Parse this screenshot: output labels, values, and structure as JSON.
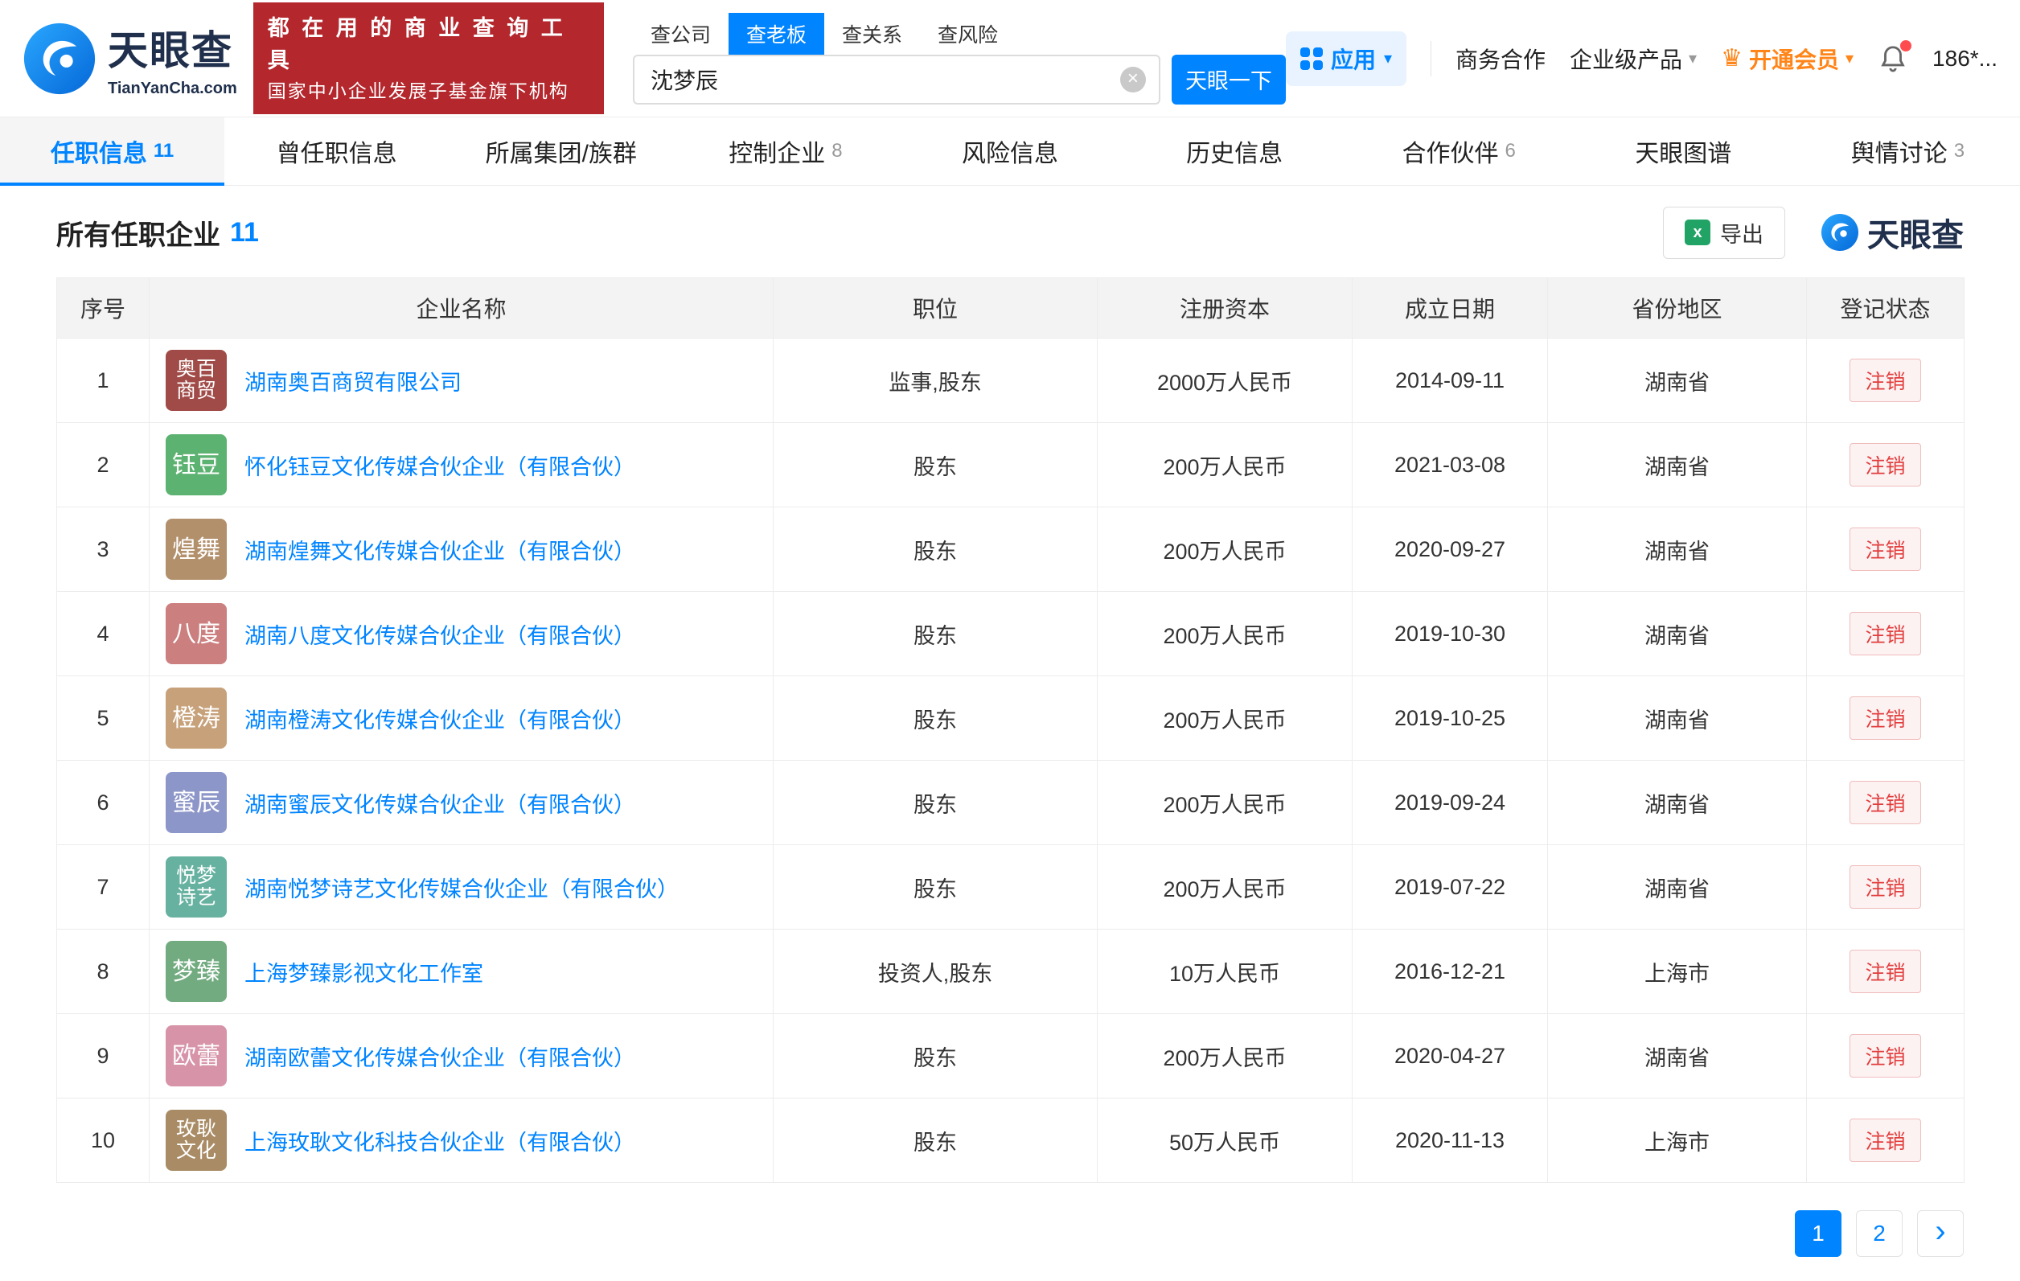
{
  "brand": {
    "name": "天眼查",
    "domain": "TianYanCha.com",
    "accent": "#0084ff"
  },
  "header": {
    "badge": {
      "line1": "都 在 用 的 商 业 查 询 工 具",
      "line2": "国家中小企业发展子基金旗下机构"
    },
    "search": {
      "tabs": [
        {
          "label": "查公司",
          "active": false
        },
        {
          "label": "查老板",
          "active": true
        },
        {
          "label": "查关系",
          "active": false
        },
        {
          "label": "查风险",
          "active": false
        }
      ],
      "value": "沈梦辰",
      "button": "天眼一下"
    },
    "nav": {
      "apps": "应用",
      "business": "商务合作",
      "enterprise": "企业级产品",
      "vip": "开通会员",
      "phone": "186*..."
    }
  },
  "tabs": [
    {
      "label": "任职信息",
      "count": "11",
      "active": true
    },
    {
      "label": "曾任职信息",
      "count": "",
      "active": false
    },
    {
      "label": "所属集团/族群",
      "count": "",
      "active": false
    },
    {
      "label": "控制企业",
      "count": "8",
      "active": false
    },
    {
      "label": "风险信息",
      "count": "",
      "active": false
    },
    {
      "label": "历史信息",
      "count": "",
      "active": false
    },
    {
      "label": "合作伙伴",
      "count": "6",
      "active": false
    },
    {
      "label": "天眼图谱",
      "count": "",
      "active": false
    },
    {
      "label": "舆情讨论",
      "count": "3",
      "active": false
    }
  ],
  "section": {
    "title": "所有任职企业",
    "count": "11",
    "export": "导出",
    "watermark": "天眼查"
  },
  "table": {
    "headers": [
      "序号",
      "企业名称",
      "职位",
      "注册资本",
      "成立日期",
      "省份地区",
      "登记状态"
    ],
    "rows": [
      {
        "no": "1",
        "logo": [
          "奥百",
          "商贸"
        ],
        "logo_color": "#a04b47",
        "name": "湖南奥百商贸有限公司",
        "position": "监事,股东",
        "capital": "2000万人民币",
        "date": "2014-09-11",
        "region": "湖南省",
        "status": "注销"
      },
      {
        "no": "2",
        "logo": [
          "钰豆"
        ],
        "logo_color": "#5cb270",
        "name": "怀化钰豆文化传媒合伙企业（有限合伙）",
        "position": "股东",
        "capital": "200万人民币",
        "date": "2021-03-08",
        "region": "湖南省",
        "status": "注销"
      },
      {
        "no": "3",
        "logo": [
          "煌舞"
        ],
        "logo_color": "#b3906c",
        "name": "湖南煌舞文化传媒合伙企业（有限合伙）",
        "position": "股东",
        "capital": "200万人民币",
        "date": "2020-09-27",
        "region": "湖南省",
        "status": "注销"
      },
      {
        "no": "4",
        "logo": [
          "八度"
        ],
        "logo_color": "#cc7f7f",
        "name": "湖南八度文化传媒合伙企业（有限合伙）",
        "position": "股东",
        "capital": "200万人民币",
        "date": "2019-10-30",
        "region": "湖南省",
        "status": "注销"
      },
      {
        "no": "5",
        "logo": [
          "橙涛"
        ],
        "logo_color": "#c7a17a",
        "name": "湖南橙涛文化传媒合伙企业（有限合伙）",
        "position": "股东",
        "capital": "200万人民币",
        "date": "2019-10-25",
        "region": "湖南省",
        "status": "注销"
      },
      {
        "no": "6",
        "logo": [
          "蜜辰"
        ],
        "logo_color": "#8d96c8",
        "name": "湖南蜜辰文化传媒合伙企业（有限合伙）",
        "position": "股东",
        "capital": "200万人民币",
        "date": "2019-09-24",
        "region": "湖南省",
        "status": "注销"
      },
      {
        "no": "7",
        "logo": [
          "悦梦",
          "诗艺"
        ],
        "logo_color": "#66b1a0",
        "name": "湖南悦梦诗艺文化传媒合伙企业（有限合伙）",
        "position": "股东",
        "capital": "200万人民币",
        "date": "2019-07-22",
        "region": "湖南省",
        "status": "注销"
      },
      {
        "no": "8",
        "logo": [
          "梦臻"
        ],
        "logo_color": "#72ab80",
        "name": "上海梦臻影视文化工作室",
        "position": "投资人,股东",
        "capital": "10万人民币",
        "date": "2016-12-21",
        "region": "上海市",
        "status": "注销"
      },
      {
        "no": "9",
        "logo": [
          "欧蕾"
        ],
        "logo_color": "#d793a8",
        "name": "湖南欧蕾文化传媒合伙企业（有限合伙）",
        "position": "股东",
        "capital": "200万人民币",
        "date": "2020-04-27",
        "region": "湖南省",
        "status": "注销"
      },
      {
        "no": "10",
        "logo": [
          "玫耿",
          "文化"
        ],
        "logo_color": "#a98c66",
        "name": "上海玫耿文化科技合伙企业（有限合伙）",
        "position": "股东",
        "capital": "50万人民币",
        "date": "2020-11-13",
        "region": "上海市",
        "status": "注销"
      }
    ]
  },
  "pagination": {
    "pages": [
      "1",
      "2"
    ],
    "active": "1",
    "next": "›"
  }
}
